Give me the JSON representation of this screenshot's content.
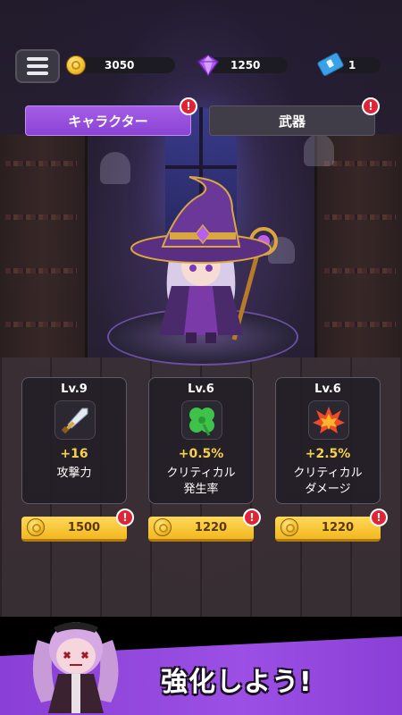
{
  "top_bar": {
    "menu_icon": "hamburger-menu-icon",
    "gold": "3050",
    "gems": "1250",
    "tickets": "1",
    "gold_icon": "gold-coin-icon",
    "gem_icon": "purple-gem-icon",
    "ticket_icon": "blue-ticket-icon"
  },
  "tabs": [
    {
      "label": "キャラクター",
      "active": true,
      "badge": "!"
    },
    {
      "label": "武器",
      "active": false,
      "badge": "!"
    }
  ],
  "stats": [
    {
      "level": "Lv.9",
      "bonus": "+16",
      "name": "攻撃力",
      "icon": "sword-icon",
      "cost": "1500",
      "badge": "!"
    },
    {
      "level": "Lv.6",
      "bonus": "+0.5%",
      "name": "クリティカル発生率",
      "name_line1": "クリティカル",
      "name_line2": "発生率",
      "icon": "four-leaf-clover-icon",
      "cost": "1220",
      "badge": "!"
    },
    {
      "level": "Lv.6",
      "bonus": "+2.5%",
      "name": "クリティカルダメージ",
      "name_line1": "クリティカル",
      "name_line2": "ダメージ",
      "icon": "explosion-icon",
      "cost": "1220",
      "badge": "!"
    }
  ],
  "banner": {
    "text": "強化しよう!"
  },
  "colors": {
    "active_tab": "#9b50e0",
    "inactive_tab": "#413d48",
    "badge": "#e02436",
    "cost_button": "#f5c22e",
    "bonus_text": "#f5d24a",
    "banner": "#9b4fe4"
  }
}
